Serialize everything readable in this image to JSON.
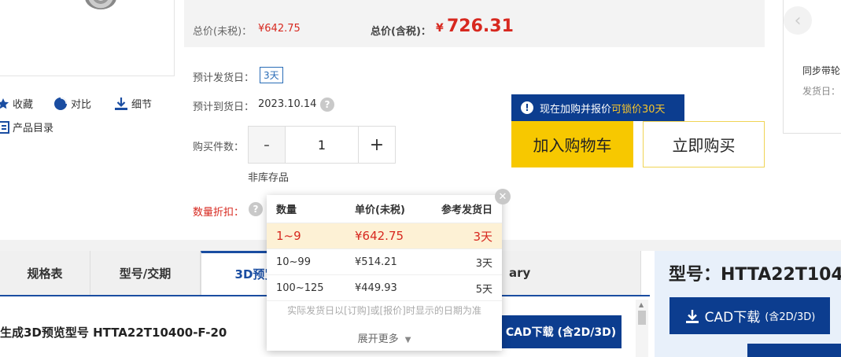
{
  "product_actions": {
    "favorite": "收藏",
    "compare": "对比",
    "details": "细节",
    "catalog": "产品目录"
  },
  "price": {
    "pretax_label": "总价(未税)：",
    "pretax_value": "¥642.75",
    "taxed_label": "总价(含税)：",
    "taxed_currency": "¥",
    "taxed_value": "726.31"
  },
  "shipping": {
    "ship_label": "预计发货日：",
    "ship_days": "3天",
    "arrive_label": "预计到货日：",
    "arrive_date": "2023.10.14"
  },
  "quantity": {
    "label": "购买件数：",
    "minus": "-",
    "value": "1",
    "plus": "+",
    "stock_note": "非库存品"
  },
  "discount_label": "数量折扣：",
  "promo": {
    "text_prefix": "现在加购并报价",
    "text_highlight": "可锁价30天"
  },
  "buttons": {
    "add_to_cart": "加入购物车",
    "buy_now": "立即购买"
  },
  "side_card": {
    "line1": "同步带轮",
    "line2": "发货日："
  },
  "tabs": [
    {
      "label": "规格表"
    },
    {
      "label": "型号/交期"
    },
    {
      "label": "3D预览"
    },
    {
      "label": "ary"
    }
  ],
  "preview": {
    "title": "生成3D预览型号 HTTA22T10400-F-20",
    "cad_button": "CAD下载 (含2D/3D)"
  },
  "model_panel": {
    "title": "型号：HTTA22T104",
    "cad_label": "CAD下载",
    "cad_sub": "(含2D/3D)"
  },
  "discount_popup": {
    "headers": [
      "数量",
      "单价(未税)",
      "参考发货日"
    ],
    "rows": [
      {
        "qty": "1~9",
        "price": "¥642.75",
        "days": "3天"
      },
      {
        "qty": "10~99",
        "price": "¥514.21",
        "days": "3天"
      },
      {
        "qty": "100~125",
        "price": "¥449.93",
        "days": "5天"
      }
    ],
    "note": "实际发货日以[订购]或[报价]时显示的日期为准",
    "more": "展开更多"
  }
}
